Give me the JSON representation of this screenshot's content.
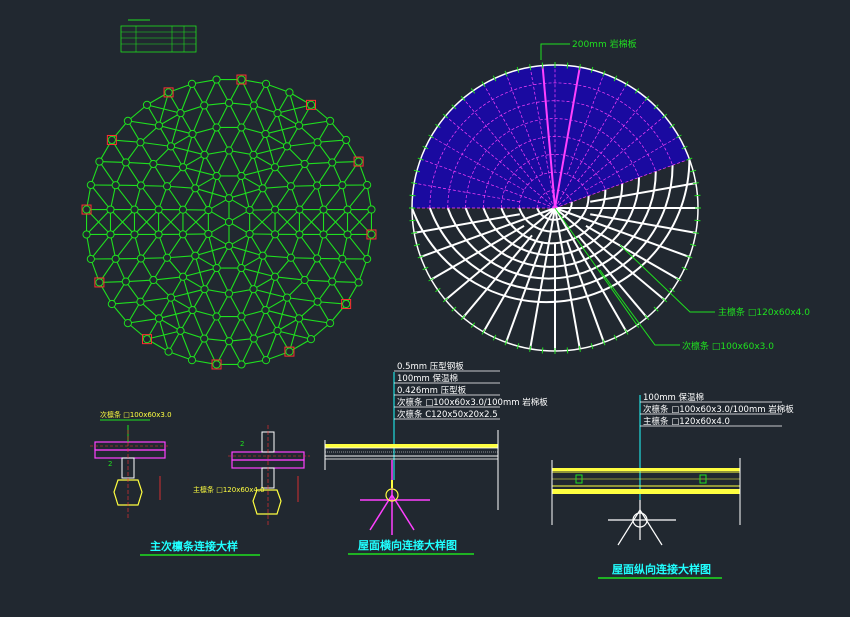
{
  "colors": {
    "background": "#212830",
    "green": "#1fe01f",
    "white": "#ffffff",
    "blue_fill": "#1a0aa0",
    "magenta": "#ff40ff",
    "red": "#ff3030",
    "yellow": "#ffff40",
    "cyan": "#20ffff"
  },
  "right_plan": {
    "callout_top": "200mm 岩棉板",
    "callout_main": "主檩条 □120x60x4.0",
    "callout_sec": "次檩条 □100x60x3.0"
  },
  "roof_section": {
    "layers": [
      "0.5mm 压型钢板",
      "100mm 保温棉",
      "0.426mm 压型板",
      "次檩条 □100x60x3.0/100mm 岩棉板",
      "次檩条 C120x50x20x2.5"
    ],
    "caption": "屋面横向连接大样图"
  },
  "long_section": {
    "layers": [
      "100mm 保温棉",
      "次檩条 □100x60x3.0/100mm 岩棉板",
      "主檩条 □120x60x4.0"
    ],
    "caption": "屋面纵向连接大样图"
  },
  "purlin_detail": {
    "label_top": "次檩条 □100x60x3.0",
    "label_side": "主檩条 □120x60x4.0",
    "caption": "主次檩条连接大样"
  }
}
